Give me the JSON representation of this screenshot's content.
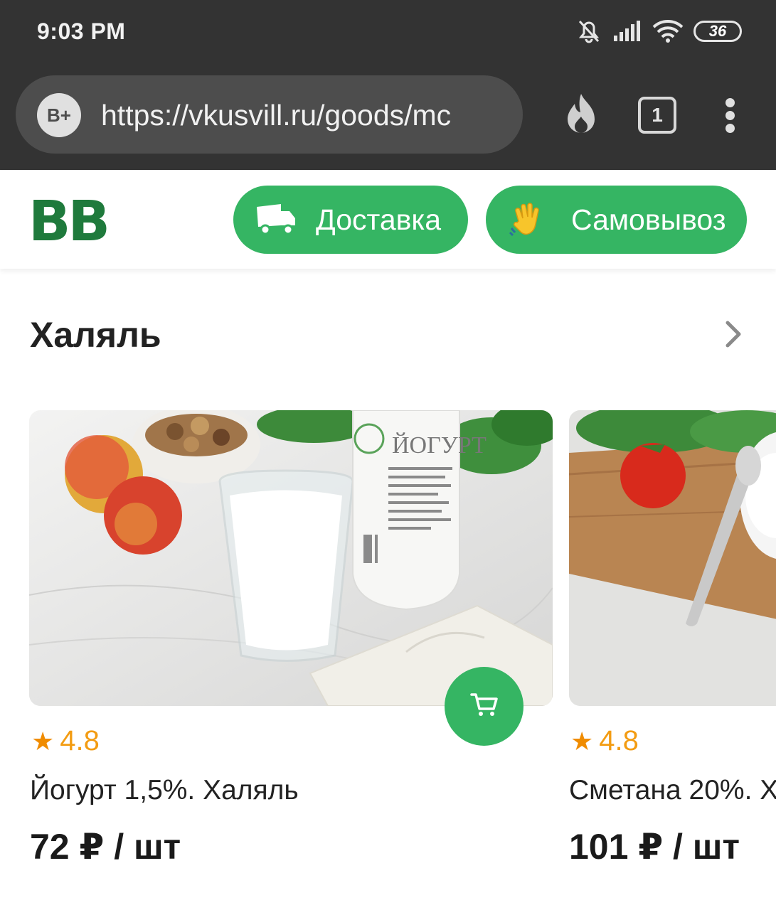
{
  "status_bar": {
    "time": "9:03 PM",
    "battery": "36"
  },
  "browser": {
    "site_badge": "B+",
    "url": "https://vkusvill.ru/goods/mc",
    "tab_count": "1"
  },
  "site": {
    "logo": "BB",
    "delivery_label": "Доставка",
    "pickup_label": "Самовывоз",
    "accent_color": "#35b563",
    "logo_color": "#1f7a3c"
  },
  "section": {
    "title": "Халяль"
  },
  "products": [
    {
      "rating": "4.8",
      "name": "Йогурт 1,5%. Халяль",
      "price": "72 ₽ / шт",
      "bottle_text": "ЙОГУРТ"
    },
    {
      "rating": "4.8",
      "name": "Сметана 20%. Х",
      "price": "101 ₽ / шт"
    }
  ]
}
